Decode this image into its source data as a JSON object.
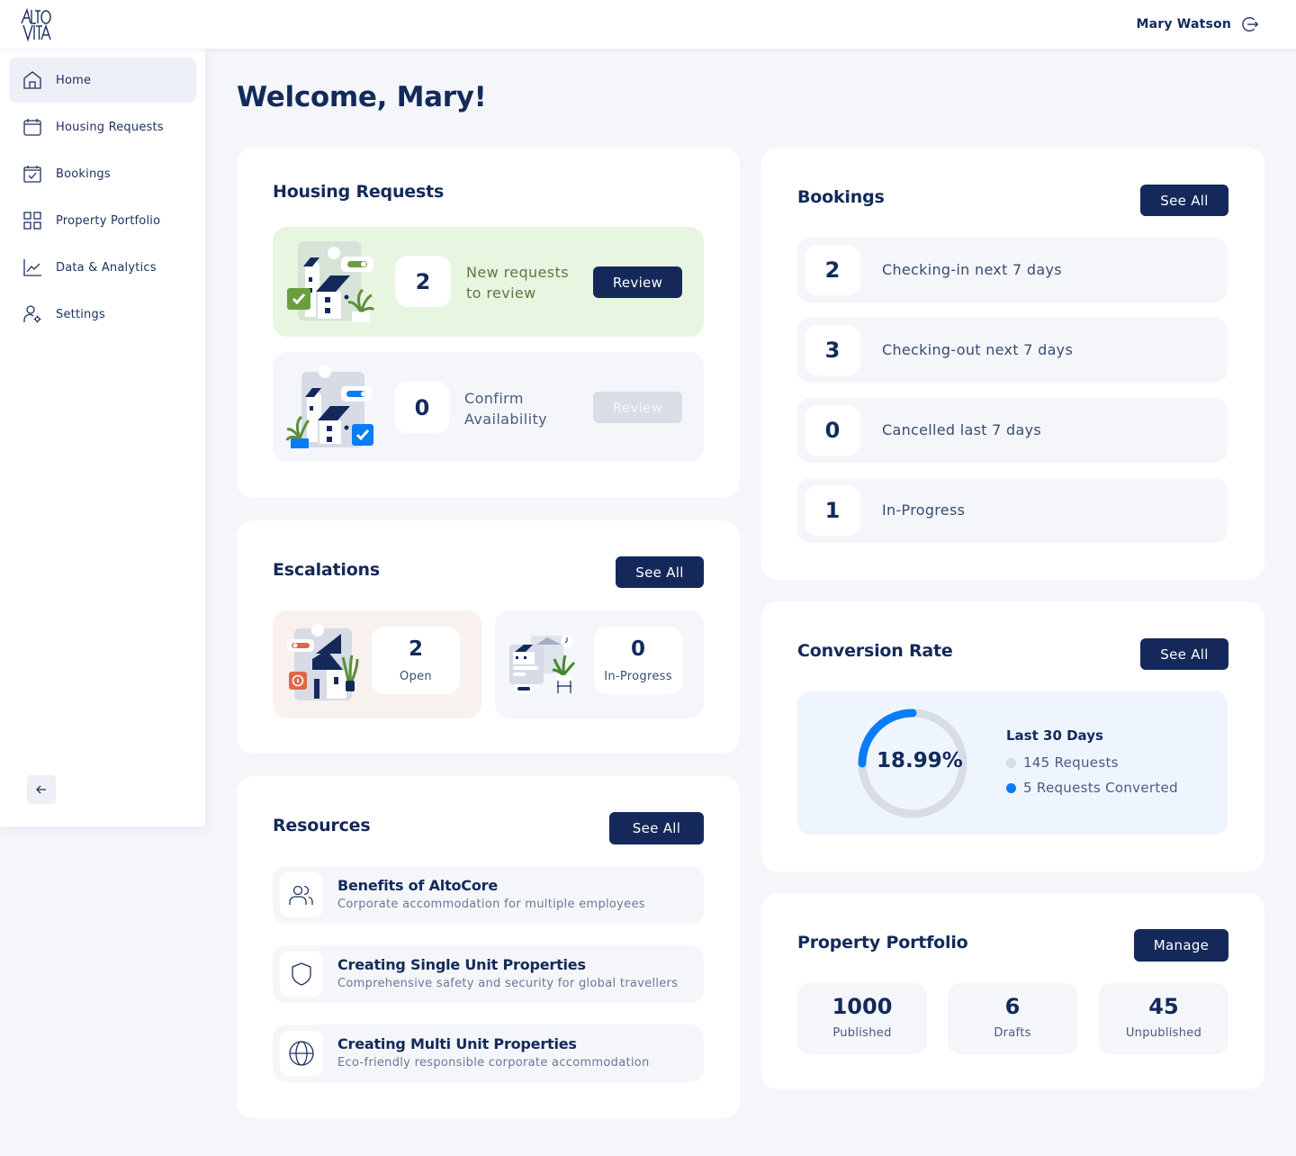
{
  "header": {
    "logo_alt": "Alto Vita",
    "user_name": "Mary Watson",
    "logout_icon": "logout-icon"
  },
  "sidebar": {
    "items": [
      {
        "label": "Home",
        "icon": "home-icon",
        "active": true
      },
      {
        "label": "Housing Requests",
        "icon": "calendar-icon",
        "active": false
      },
      {
        "label": "Bookings",
        "icon": "calendar-check-icon",
        "active": false
      },
      {
        "label": "Property Portfolio",
        "icon": "grid-icon",
        "active": false
      },
      {
        "label": "Data & Analytics",
        "icon": "line-chart-icon",
        "active": false
      },
      {
        "label": "Settings",
        "icon": "user-settings-icon",
        "active": false
      }
    ],
    "collapse_icon": "arrow-left-icon"
  },
  "main": {
    "welcome": "Welcome, Mary!",
    "housing_requests": {
      "title": "Housing Requests",
      "tiles": [
        {
          "count": "2",
          "label_line1": "New requests",
          "label_line2": "to review",
          "button": "Review",
          "enabled": true,
          "bg": "#e8f5e0",
          "text_color": "#5a7a46"
        },
        {
          "count": "0",
          "label_line1": "Confirm",
          "label_line2": "Availability",
          "button": "Review",
          "enabled": false,
          "bg": "#f4f6fa",
          "text_color": "#4a5b7e"
        }
      ]
    },
    "escalations": {
      "title": "Escalations",
      "see_all": "See All",
      "tiles": [
        {
          "count": "2",
          "label": "Open",
          "bg": "#f9f1ee"
        },
        {
          "count": "0",
          "label": "In-Progress",
          "bg": "#f4f6fa"
        }
      ]
    },
    "resources": {
      "title": "Resources",
      "see_all": "See All",
      "items": [
        {
          "title": "Benefits of AltoCore",
          "subtitle": "Corporate accommodation for multiple employees",
          "icon": "users-icon"
        },
        {
          "title": "Creating Single Unit Properties",
          "subtitle": "Comprehensive safety and security for global travellers",
          "icon": "shield-icon"
        },
        {
          "title": "Creating Multi Unit Properties",
          "subtitle": "Eco-friendly responsible corporate accommodation",
          "icon": "globe-icon"
        }
      ]
    },
    "bookings": {
      "title": "Bookings",
      "see_all": "See All",
      "rows": [
        {
          "count": "2",
          "label": "Checking-in next 7 days"
        },
        {
          "count": "3",
          "label": "Checking-out next 7 days"
        },
        {
          "count": "0",
          "label": "Cancelled last 7 days"
        },
        {
          "count": "1",
          "label": "In-Progress"
        }
      ]
    },
    "conversion": {
      "title": "Conversion Rate",
      "see_all": "See All",
      "percent_label": "18.99%",
      "period": "Last 30 Days",
      "legend": [
        {
          "label": "145 Requests",
          "color": "#d8dce6"
        },
        {
          "label": "5 Requests Converted",
          "color": "#0a7cf5"
        }
      ],
      "ring_fill_fraction": 0.25,
      "ring_color": "#0a7cf5",
      "ring_track_color": "#d8dce6"
    },
    "portfolio": {
      "title": "Property Portfolio",
      "manage": "Manage",
      "stats": [
        {
          "count": "1000",
          "label": "Published"
        },
        {
          "count": "6",
          "label": "Drafts"
        },
        {
          "count": "45",
          "label": "Unpublished"
        }
      ]
    }
  },
  "colors": {
    "primary": "#14295a",
    "accent_blue": "#0a7cf5",
    "success_green": "#6a9e3f",
    "alert_orange": "#e0664a"
  }
}
